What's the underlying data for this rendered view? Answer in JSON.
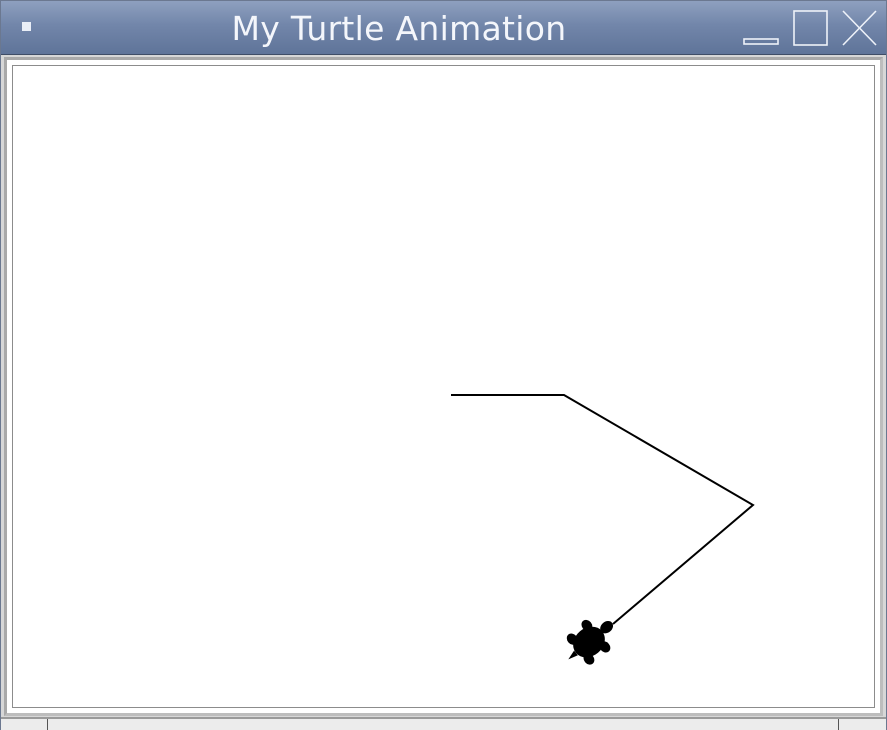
{
  "window": {
    "title": "My Turtle Animation",
    "titlebar_color": "#7286aa",
    "title_text_color": "#f4f6fb"
  },
  "controls": {
    "menu_icon": "window-menu-icon",
    "minimize_icon": "minimize-icon",
    "maximize_icon": "maximize-icon",
    "close_icon": "close-icon"
  },
  "canvas": {
    "background": "#ffffff",
    "pen_color": "#000000",
    "turtle_shape": "turtle-icon",
    "turtle_color": "#000000"
  }
}
